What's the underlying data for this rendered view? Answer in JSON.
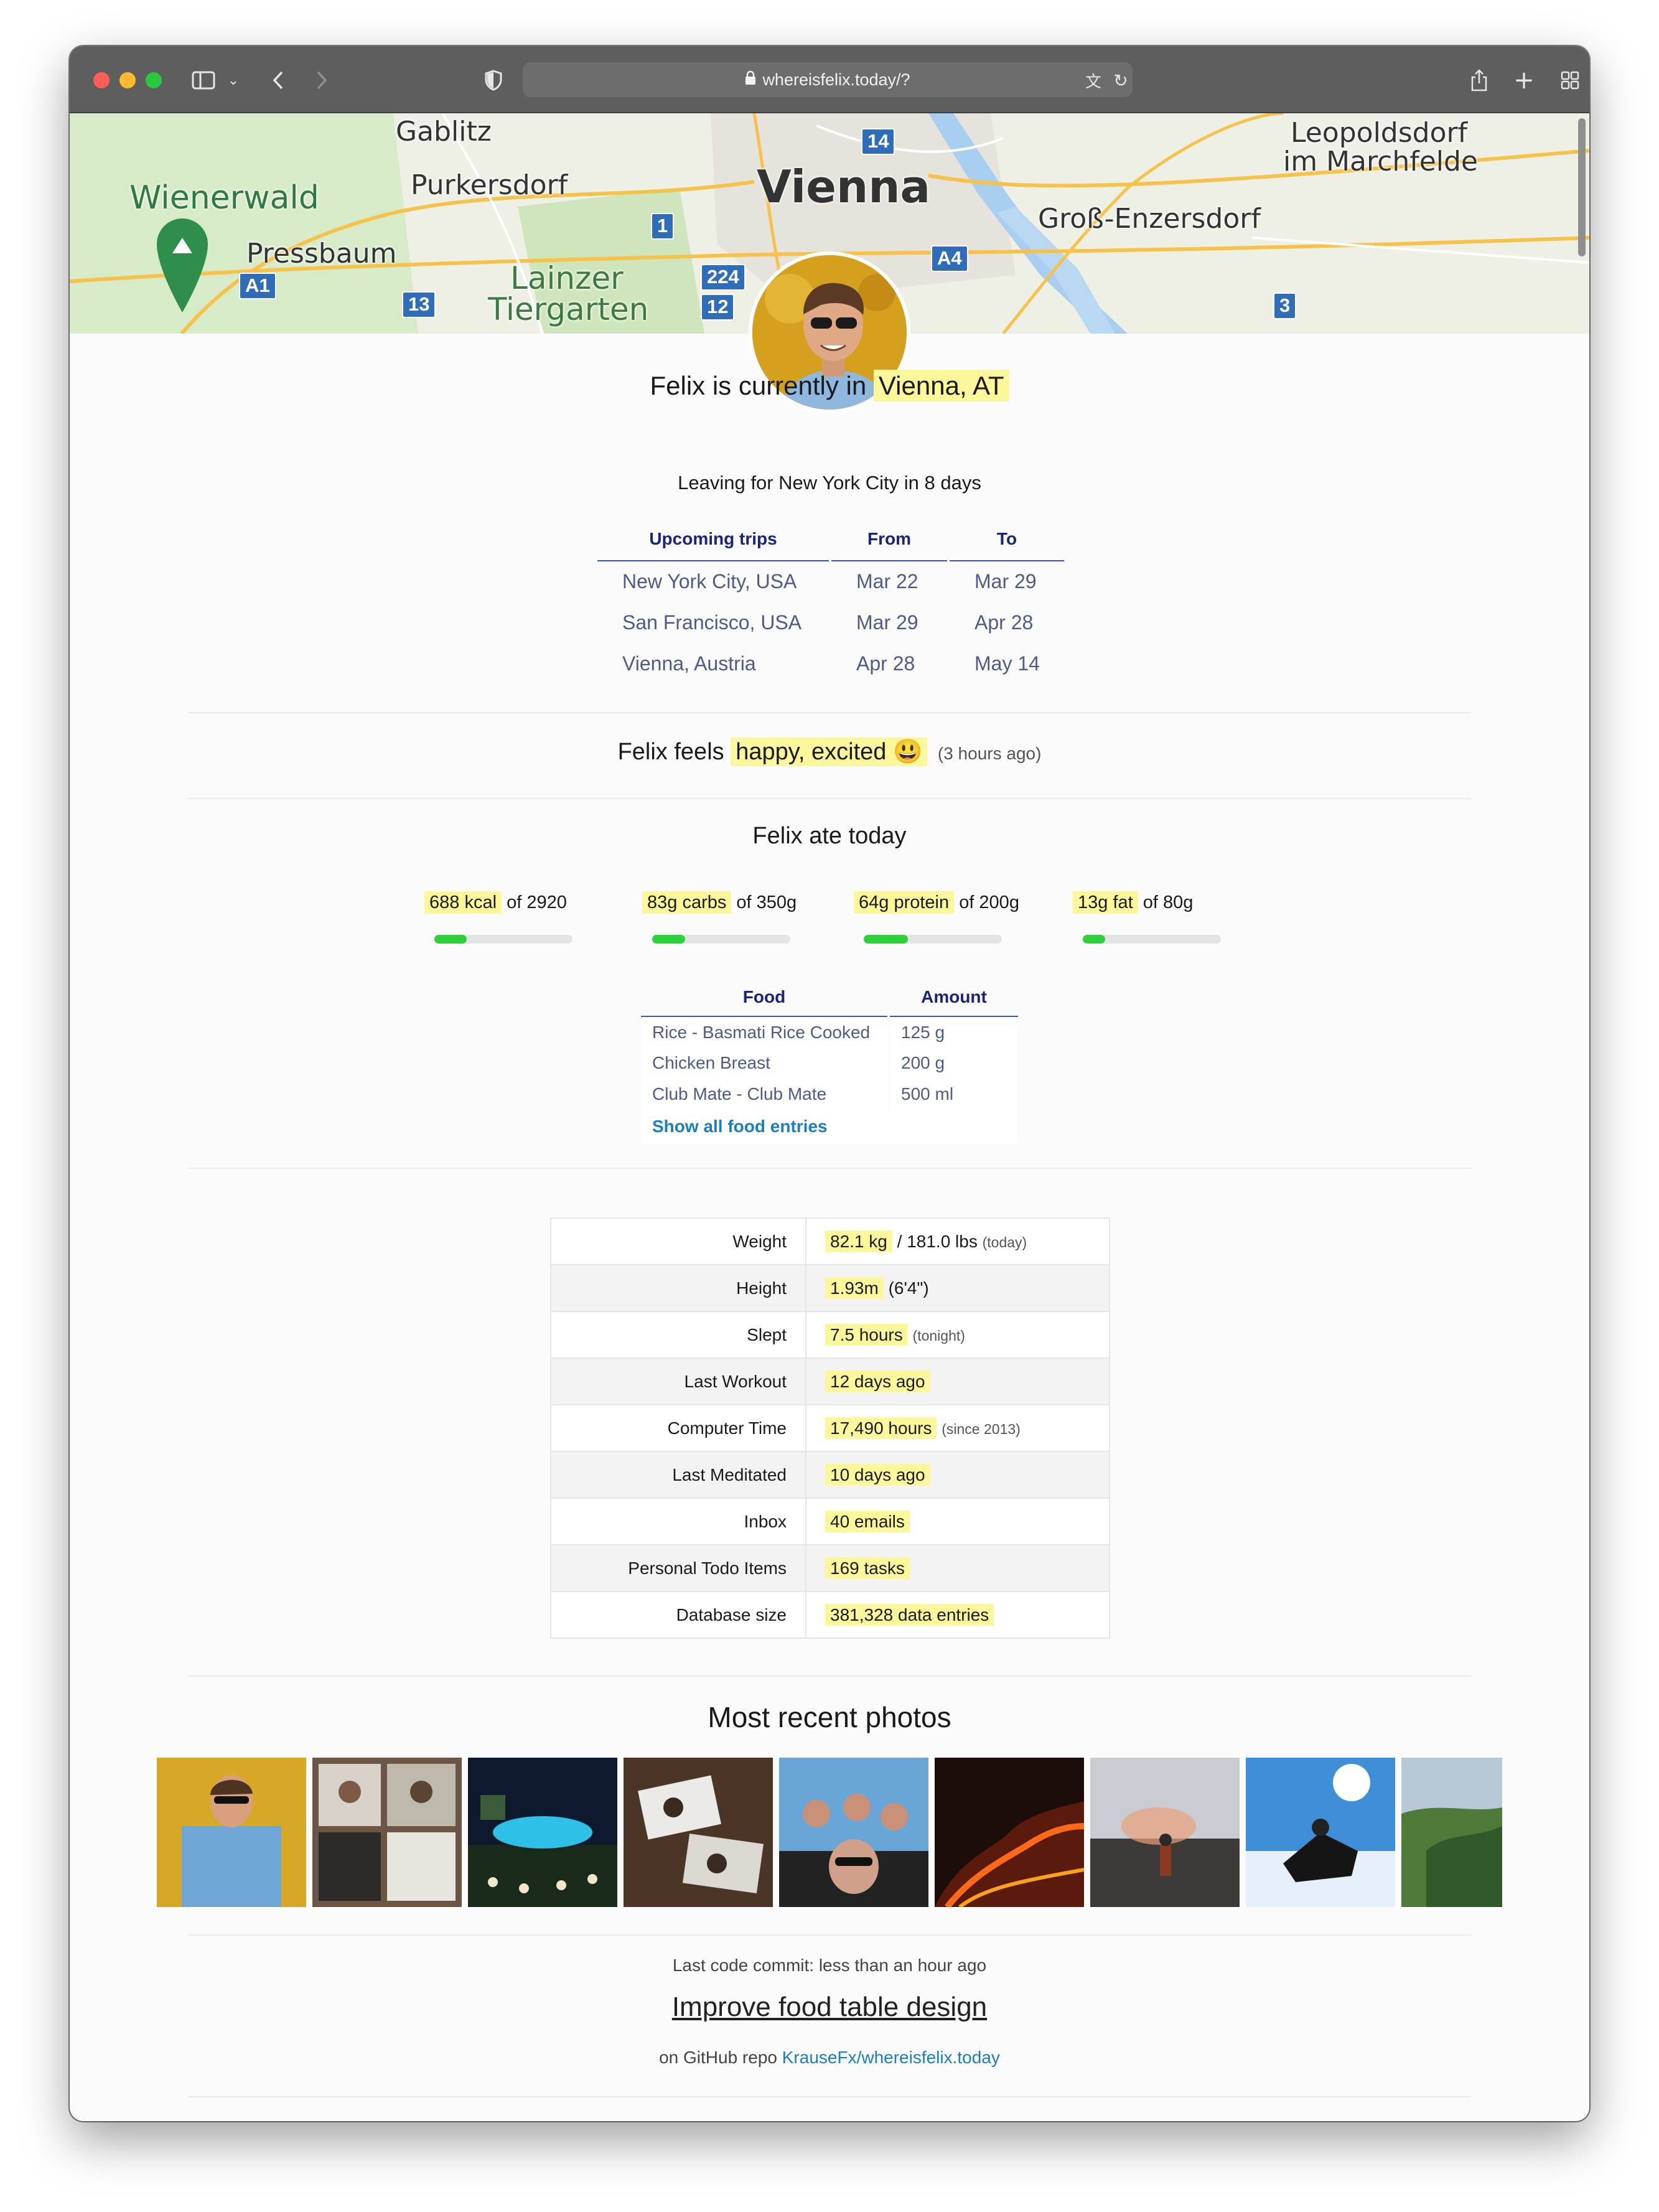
{
  "browser": {
    "url": "whereisfelix.today/?",
    "lock_icon": "lock-icon",
    "colors": {
      "close": "#ff5f57",
      "minimize": "#febc2e",
      "zoom": "#28c840"
    }
  },
  "map": {
    "labels": {
      "vienna": "Vienna",
      "gablitz": "Gablitz",
      "purkersdorf": "Purkersdorf",
      "wienerwald": "Wienerwald",
      "pressbaum": "Pressbaum",
      "lainzer_1": "Lainzer",
      "lainzer_2": "Tiergarten",
      "gross_enzersdorf": "Groß-Enzersdorf",
      "leopoldsdorf_1": "Leopoldsdorf",
      "leopoldsdorf_2": "im Marchfelde"
    },
    "shields": {
      "s14": "14",
      "s1": "1",
      "s224": "224",
      "s12": "12",
      "s13": "13",
      "a1": "A1",
      "a4": "A4",
      "s3": "3"
    }
  },
  "status": {
    "prefix": "Felix is currently in",
    "location": "Vienna, AT",
    "subtitle": "Leaving for New York City in 8 days"
  },
  "trips": {
    "headers": [
      "Upcoming trips",
      "From",
      "To"
    ],
    "rows": [
      [
        "New York City, USA",
        "Mar 22",
        "Mar 29"
      ],
      [
        "San Francisco, USA",
        "Mar 29",
        "Apr 28"
      ],
      [
        "Vienna, Austria",
        "Apr 28",
        "May 14"
      ]
    ]
  },
  "mood": {
    "prefix": "Felix feels",
    "value": "happy, excited 😃",
    "time": "(3 hours ago)"
  },
  "nutrition": {
    "title": "Felix ate today",
    "macros": [
      {
        "value": "688 kcal",
        "of": "of 2920",
        "fraction": 0.236
      },
      {
        "value": "83g carbs",
        "of": "of 350g",
        "fraction": 0.237
      },
      {
        "value": "64g protein",
        "of": "of 200g",
        "fraction": 0.32
      },
      {
        "value": "13g fat",
        "of": "of 80g",
        "fraction": 0.163
      }
    ],
    "colors": {
      "bar_fill": "#2fd13a",
      "bar_track": "#e4e4e4",
      "highlight": "#fdf79c"
    },
    "food_headers": [
      "Food",
      "Amount"
    ],
    "foods": [
      [
        "Rice - Basmati Rice Cooked",
        "125 g"
      ],
      [
        "Chicken Breast",
        "200 g"
      ],
      [
        "Club Mate - Club Mate",
        "500 ml"
      ]
    ],
    "show_all": "Show all food entries"
  },
  "stats": [
    {
      "label": "Weight",
      "value": "82.1 kg",
      "extra": "/ 181.0 lbs",
      "note": "(today)"
    },
    {
      "label": "Height",
      "value": "1.93m",
      "extra": "(6'4\")",
      "note": ""
    },
    {
      "label": "Slept",
      "value": "7.5 hours",
      "extra": "",
      "note": "(tonight)"
    },
    {
      "label": "Last Workout",
      "value": "12 days ago",
      "extra": "",
      "note": ""
    },
    {
      "label": "Computer Time",
      "value": "17,490 hours",
      "extra": "",
      "note": "(since 2013)"
    },
    {
      "label": "Last Meditated",
      "value": "10 days ago",
      "extra": "",
      "note": ""
    },
    {
      "label": "Inbox",
      "value": "40 emails",
      "extra": "",
      "note": ""
    },
    {
      "label": "Personal Todo Items",
      "value": "169 tasks",
      "extra": "",
      "note": ""
    },
    {
      "label": "Database size",
      "value": "381,328 data entries",
      "extra": "",
      "note": ""
    }
  ],
  "photos": {
    "title": "Most recent photos",
    "count": 9
  },
  "commit": {
    "label": "Last code commit: less than an hour ago",
    "message": "Improve food table design",
    "repo_prefix": "on GitHub repo",
    "repo": "KrauseFx/whereisfelix.today"
  }
}
